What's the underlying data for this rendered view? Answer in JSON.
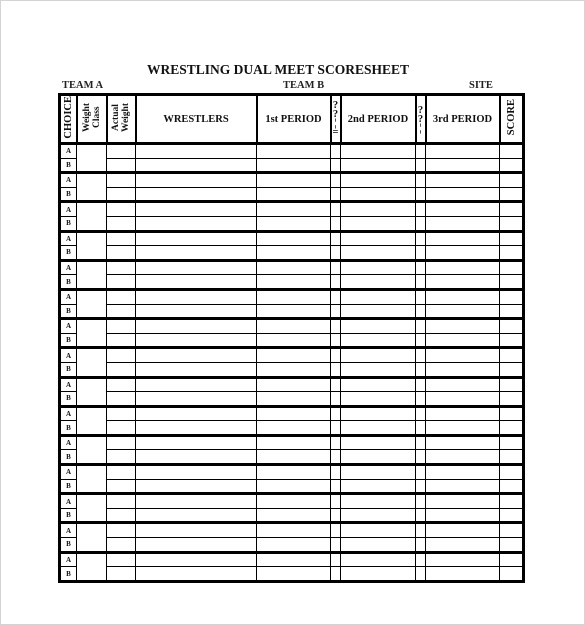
{
  "document": {
    "title": "WRESTLING DUAL MEET SCORESHEET",
    "fields": {
      "team_a": "TEAM A",
      "team_b": "TEAM B",
      "site": "SITE"
    },
    "table": {
      "headers": {
        "choice": "CHOICE",
        "weight_class": "Weight Class",
        "weight_class_line1": "Weight",
        "weight_class_line2": "Class",
        "actual_weight_line1": "Actual",
        "actual_weight_line2": "Weight",
        "wrestlers": "WRESTLERS",
        "period1": "1st PERIOD",
        "choice_mark_1": [
          "?",
          "?",
          "¦",
          "="
        ],
        "period2": "2nd PERIOD",
        "choice_mark_2": [
          "?",
          "?",
          "¦"
        ],
        "period3": "3rd PERIOD",
        "score": "SCORE"
      },
      "row_pairs": 15,
      "row_labels": [
        "A",
        "B"
      ]
    }
  }
}
